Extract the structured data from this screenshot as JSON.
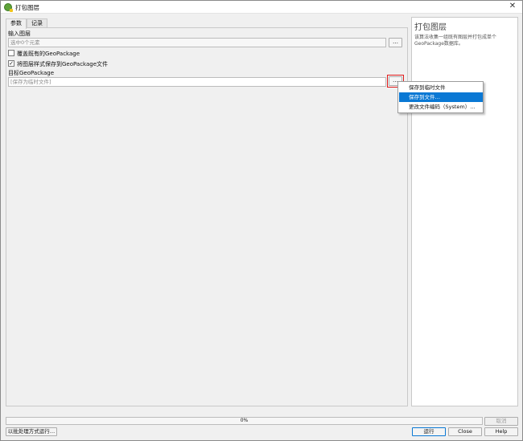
{
  "window": {
    "title": "打包图层",
    "close_glyph": "✕"
  },
  "tabs": [
    {
      "label": "参数",
      "active": true
    },
    {
      "label": "记录",
      "active": false
    }
  ],
  "params": {
    "input_layers_label": "输入图层",
    "input_layers_value": "选中0个元素",
    "input_dots": "…",
    "overwrite_label": "覆盖既有的GeoPackage",
    "overwrite_checked": false,
    "save_styles_label": "将图层样式保存到GeoPackage文件",
    "save_styles_checked": true,
    "check_glyph": "✓",
    "destination_label": "目标GeoPackage",
    "destination_placeholder": "[保存为临时文件]",
    "destination_dots": "…"
  },
  "help": {
    "title": "打包图层",
    "body": "该算法收集一组既有图层并打包成单个GeoPackage数据库。"
  },
  "dropdown_menu": {
    "items": [
      {
        "label": "保存到临时文件",
        "selected": false
      },
      {
        "label": "保存到文件…",
        "selected": true
      },
      {
        "label": "更改文件编码（System）…",
        "selected": false
      }
    ]
  },
  "progress": {
    "value": 0,
    "label": "0%"
  },
  "footer": {
    "batch_label": "以批处理方式运行…",
    "cancel_label": "取消",
    "run_label": "运行",
    "close_label": "Close",
    "help_label": "Help"
  },
  "colors": {
    "accent": "#0a78d4",
    "highlight_border": "#e01b1b",
    "qgis_icon": "#5fa33a"
  },
  "icons": {
    "app": "qgis-logo-icon",
    "close": "close-icon",
    "browse": "ellipsis-icon",
    "check": "checkmark-icon"
  }
}
